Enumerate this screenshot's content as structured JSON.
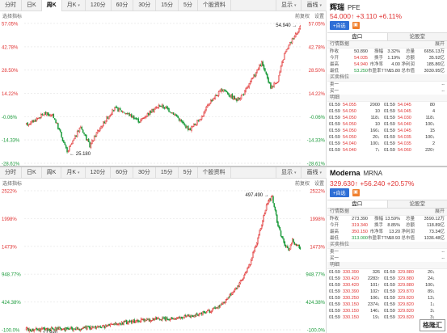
{
  "tabs": [
    "分时",
    "日K",
    "周K",
    "月K",
    "120分",
    "60分",
    "30分",
    "15分",
    "5分",
    "个股资料"
  ],
  "tabs_right": [
    "显示",
    "画线"
  ],
  "top": {
    "active_tab": 2,
    "sub_left": "选择指标",
    "sub_right": [
      "前复权",
      "设置"
    ],
    "name": "辉瑞",
    "code": "PFE",
    "price": "54.000",
    "price_change": "↑ +3.110 +6.11%",
    "add_label": "+自选",
    "qtabs": [
      "盘口",
      "论股堂"
    ],
    "sec_quote": "行情数据",
    "sec_expand": "展开",
    "stats": [
      [
        "昨收",
        "50.890",
        "振幅",
        "3.32%",
        "总量",
        "6656.13万"
      ],
      [
        "今开",
        "54.035",
        "换手",
        "1.19%",
        "总额",
        "35.92亿"
      ],
      [
        "最高",
        "54.940",
        "市净率",
        "4.00",
        "净利润",
        "185.86亿"
      ],
      [
        "最低",
        "53.250",
        "市盈率TTM",
        "15.80",
        "总市值",
        "3030.95亿"
      ]
    ],
    "sec_book": "买卖档位",
    "sell1": "卖一",
    "buy1": "买一",
    "sec_detail": "明细",
    "ticks": [
      [
        "01:59",
        "54.055",
        "2000",
        "01:59",
        "54.045",
        "80"
      ],
      [
        "01:59",
        "54.050",
        "10",
        "01:59",
        "54.045",
        "4"
      ],
      [
        "01:59",
        "54.050",
        "118↓",
        "01:59",
        "54.030",
        "118↓"
      ],
      [
        "01:59",
        "54.050",
        "10",
        "01:59",
        "54.040",
        "100↓"
      ],
      [
        "01:59",
        "54.050",
        "166↓",
        "01:59",
        "54.045",
        "15"
      ],
      [
        "01:59",
        "54.050",
        "20↓",
        "01:59",
        "54.035",
        "100↓"
      ],
      [
        "01:59",
        "54.040",
        "100↓",
        "01:59",
        "54.035",
        "2"
      ],
      [
        "01:59",
        "54.040",
        "7↓",
        "01:59",
        "54.060",
        "220↑"
      ]
    ],
    "chart_data": {
      "type": "candlestick",
      "y_axis_labels": [
        "57.05%",
        "42.78%",
        "28.50%",
        "14.22%",
        "-0.06%",
        "-14.33%",
        "-28.61%"
      ],
      "ylim": [
        -28.61,
        57.05
      ],
      "annotations": [
        {
          "text": "54.940",
          "label_of": "high"
        },
        {
          "text": "25.180",
          "label_of": "low"
        }
      ],
      "anchors": [
        [
          0,
          -5
        ],
        [
          8,
          -2
        ],
        [
          16,
          2
        ],
        [
          24,
          0
        ],
        [
          30,
          -10
        ],
        [
          36,
          -22
        ],
        [
          42,
          -14
        ],
        [
          48,
          -6
        ],
        [
          56,
          -18
        ],
        [
          62,
          -10
        ],
        [
          70,
          -2
        ],
        [
          78,
          5
        ],
        [
          86,
          3
        ],
        [
          94,
          0
        ],
        [
          100,
          -3
        ],
        [
          106,
          1
        ],
        [
          112,
          4
        ],
        [
          118,
          7
        ],
        [
          124,
          5
        ],
        [
          132,
          1
        ],
        [
          138,
          -4
        ],
        [
          144,
          -8
        ],
        [
          150,
          -4
        ],
        [
          156,
          1
        ],
        [
          162,
          9
        ],
        [
          168,
          13
        ],
        [
          174,
          17
        ],
        [
          180,
          13
        ],
        [
          186,
          10
        ],
        [
          192,
          14
        ],
        [
          198,
          21
        ],
        [
          204,
          28
        ],
        [
          208,
          33
        ],
        [
          212,
          25
        ],
        [
          216,
          18
        ],
        [
          222,
          22
        ],
        [
          228,
          38
        ],
        [
          234,
          46
        ],
        [
          239,
          52
        ],
        [
          242,
          55
        ]
      ]
    }
  },
  "bottom": {
    "active_tab": -1,
    "sub_left": "选择指标",
    "sub_right": [
      "前复权",
      "设置"
    ],
    "name": "Moderna",
    "code": "MRNA",
    "price": "329.630",
    "price_change": "↑ +56.240 +20.57%",
    "add_label": "+自选",
    "qtabs": [
      "盘口",
      "论股堂"
    ],
    "sec_quote": "行情数据",
    "sec_expand": "展开",
    "stats": [
      [
        "昨收",
        "273.390",
        "振幅",
        "13.59%",
        "总量",
        "3590.12万"
      ],
      [
        "今开",
        "319.340",
        "换手",
        "8.85%",
        "总额",
        "118.89亿"
      ],
      [
        "最高",
        "350.150",
        "市净率",
        "13.20",
        "净利润",
        "73.34亿"
      ],
      [
        "最低",
        "313.000",
        "市盈率TTM",
        "18.93",
        "总市值",
        "1336.48亿"
      ]
    ],
    "sec_book": "买卖档位",
    "sell1": "卖一",
    "buy1": "买一",
    "sec_detail": "明细",
    "ticks": [
      [
        "01:59",
        "330.390",
        "326",
        "01:59",
        "329.880",
        "20↓"
      ],
      [
        "01:59",
        "330.420",
        "2283↑",
        "01:59",
        "329.880",
        "24↓"
      ],
      [
        "01:59",
        "330.420",
        "101↑",
        "01:59",
        "329.880",
        "100↓"
      ],
      [
        "01:59",
        "330.390",
        "102↑",
        "01:59",
        "329.870",
        "89↓"
      ],
      [
        "01:59",
        "330.250",
        "106↓",
        "01:59",
        "329.820",
        "13↓"
      ],
      [
        "01:59",
        "330.150",
        "2374↓",
        "01:59",
        "329.820",
        "1↓"
      ],
      [
        "01:59",
        "330.150",
        "146↓",
        "01:59",
        "329.820",
        "3↓"
      ],
      [
        "01:59",
        "330.150",
        "19↓",
        "01:59",
        "329.820",
        "3↓"
      ]
    ],
    "logo_text": "格隆汇",
    "chart_data": {
      "type": "candlestick",
      "y_axis_labels": [
        "2522%",
        "1998%",
        "1473%",
        "948.77%",
        "424.38%",
        "-100.0%"
      ],
      "ylim": [
        -100,
        2522
      ],
      "annotations": [
        {
          "text": "497.490",
          "label_of": "high"
        },
        {
          "text": "17.880",
          "label_of": "low"
        }
      ],
      "anchors": [
        [
          0,
          -90
        ],
        [
          20,
          -88
        ],
        [
          40,
          -85
        ],
        [
          60,
          -70
        ],
        [
          80,
          -40
        ],
        [
          100,
          30
        ],
        [
          120,
          80
        ],
        [
          140,
          110
        ],
        [
          160,
          130
        ],
        [
          180,
          190
        ],
        [
          200,
          330
        ],
        [
          210,
          520
        ],
        [
          218,
          700
        ],
        [
          225,
          900
        ],
        [
          232,
          1150
        ],
        [
          238,
          1500
        ],
        [
          244,
          1900
        ],
        [
          250,
          2300
        ],
        [
          255,
          2420
        ],
        [
          260,
          1950
        ],
        [
          264,
          1700
        ],
        [
          268,
          1500
        ],
        [
          272,
          1400
        ],
        [
          276,
          1600
        ],
        [
          280,
          1480
        ],
        [
          284,
          1450
        ]
      ]
    }
  }
}
